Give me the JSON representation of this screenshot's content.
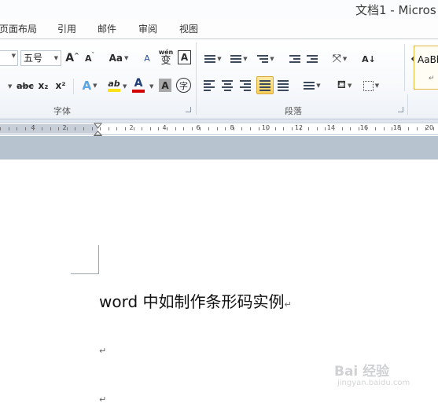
{
  "window": {
    "title": "文档1 - Micros"
  },
  "tabs": [
    "页面布局",
    "引用",
    "邮件",
    "审阅",
    "视图"
  ],
  "font": {
    "size_value": "五号",
    "grow_label": "A",
    "shrink_label": "A",
    "case_label": "Aa",
    "strike_label": "abc",
    "sub_label": "x₂",
    "sup_label": "x²",
    "text_effect_label": "A",
    "highlight_label": "ab",
    "font_color_label": "A",
    "char_shading_label": "A",
    "enclose_label": "字",
    "phonetic_label": "wén",
    "phonetic_char": "变",
    "border_label": "A",
    "clear_label": "A",
    "highlight_color": "#ffe11a",
    "font_color": "#d40000",
    "group_label": "字体"
  },
  "paragraph": {
    "group_label": "段落"
  },
  "styles": {
    "sample": "AaBb",
    "mark": "↵"
  },
  "ruler": {
    "numbers": [
      "4",
      "2",
      "2",
      "4",
      "6",
      "8",
      "10",
      "12",
      "14",
      "16",
      "18",
      "20"
    ]
  },
  "document": {
    "heading": "word 中如制作条形码实例",
    "paragraph_mark": "↵"
  },
  "watermark": {
    "main": "Bai 经验",
    "sub": "jingyan.baidu.com"
  }
}
